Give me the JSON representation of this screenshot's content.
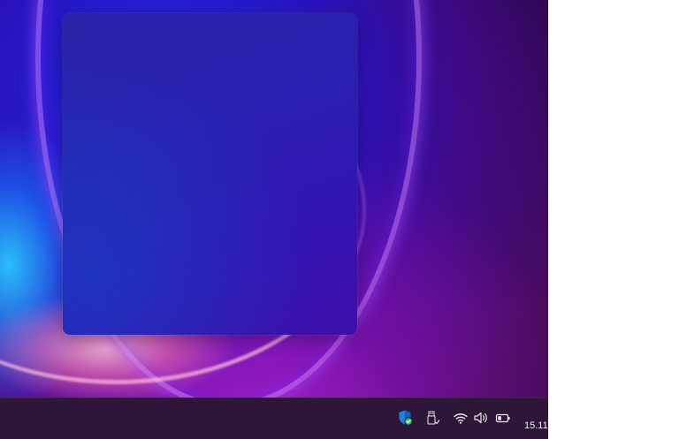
{
  "desktop": {
    "wallpaper": "windows-bloom-wallpaper"
  },
  "widget_panel": {
    "state": "empty"
  },
  "taskbar": {
    "tray_icons": [
      {
        "name": "windows-security-icon",
        "color": "#1e90ff"
      },
      {
        "name": "usb-drive-icon"
      },
      {
        "name": "wifi-icon"
      },
      {
        "name": "volume-icon"
      },
      {
        "name": "battery-icon"
      }
    ],
    "clock": {
      "time": "15.11"
    }
  },
  "colors": {
    "taskbar_bg": "#2e1638",
    "panel_bg": "#2a1fb0",
    "security_badge": "#22c55e"
  }
}
